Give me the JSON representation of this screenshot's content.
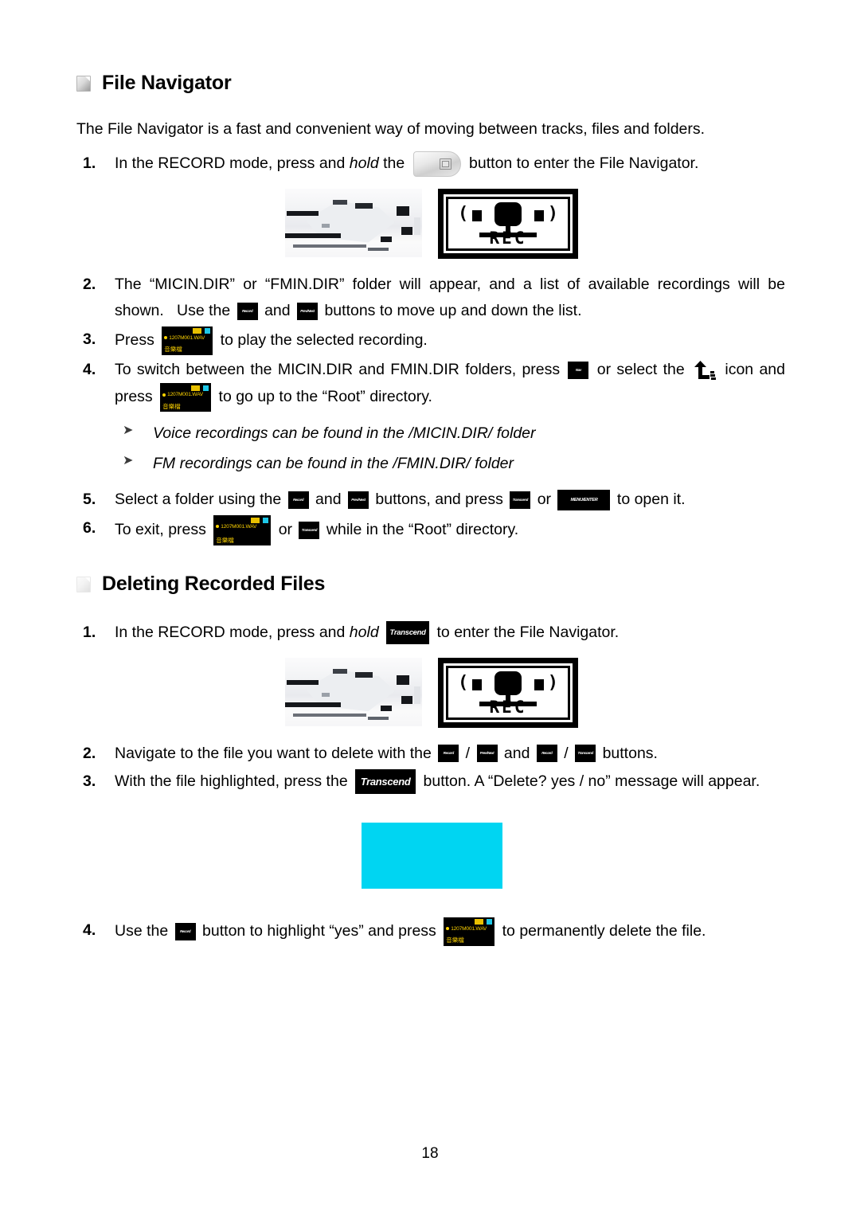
{
  "page": {
    "number": "18"
  },
  "sections": [
    {
      "id": "file-navigator",
      "heading": "File Navigator",
      "intro": "The File Navigator is a fast and convenient way of moving between tracks, files and folders."
    },
    {
      "id": "deleting-recorded-files",
      "heading": "Deleting Recorded Files"
    }
  ],
  "nav_steps": {
    "s1": {
      "num": "1.",
      "a": "In the RECORD mode, press and ",
      "hold": "hold",
      "b": " the ",
      "c": " button to enter the File Navigator."
    },
    "s2": {
      "num": "2.",
      "a": "The “MICIN.DIR” or “FMIN.DIR” folder will appear, and a list of available recordings will be shown.   Use the ",
      "b": " and ",
      "c": " buttons to move up and down the list."
    },
    "s3": {
      "num": "3.",
      "a": "Press ",
      "b": " to play the selected recording."
    },
    "s4": {
      "num": "4.",
      "a": "To switch between the MICIN.DIR and FMIN.DIR folders, press ",
      "b": " or select the ",
      "c": " icon and press ",
      "d": " to go up to the “Root” directory."
    },
    "s5": {
      "num": "5.",
      "a": "Select a folder using the ",
      "b": " and ",
      "c": " buttons, and press ",
      "d": " or ",
      "e": " to open it."
    },
    "s6": {
      "num": "6.",
      "a": "To exit, press ",
      "b": " or ",
      "c": " while in the “Root” directory."
    }
  },
  "notes": [
    {
      "arrow": "➤",
      "text": "Voice recordings can be found in the /MICIN.DIR/ folder"
    },
    {
      "arrow": "➤",
      "text": "FM recordings can be found in the /FMIN.DIR/ folder"
    }
  ],
  "delete_steps": {
    "s1": {
      "num": "1.",
      "a": "In the RECORD mode, press and ",
      "hold": "hold",
      "b": " ",
      "c": " to enter the File Navigator."
    },
    "s2": {
      "num": "2.",
      "a": "Navigate to the file you want to delete with the ",
      "b": " / ",
      "c": " and ",
      "d": " / ",
      "e": " buttons."
    },
    "s3": {
      "num": "3.",
      "a": "With the file highlighted, press the ",
      "b": " button. A “Delete? yes / no” message will appear."
    },
    "s4": {
      "num": "4.",
      "a": "Use the ",
      "b": " button to highlight “yes” and press ",
      "c": " to permanently delete the file."
    }
  },
  "chips": {
    "key_transcend": "Transcend",
    "key_record": "Record",
    "key_prevnext": "Prev/Next",
    "key_menu_enter": "MENU/ENTER",
    "key_play": "Play",
    "key_nav": "Nav"
  },
  "lcd": {
    "file_name": "1207M001.WAV",
    "cjk": "音樂檔",
    "badge_yellow_color": "#e8c000",
    "badge_cyan_color": "#1ec8e8",
    "text_color": "#ffd400"
  },
  "display": {
    "rec_label": "REC",
    "paren_left": "(",
    "paren_right": ")"
  },
  "placeholder": {
    "cyan_color": "#00d5f2"
  }
}
